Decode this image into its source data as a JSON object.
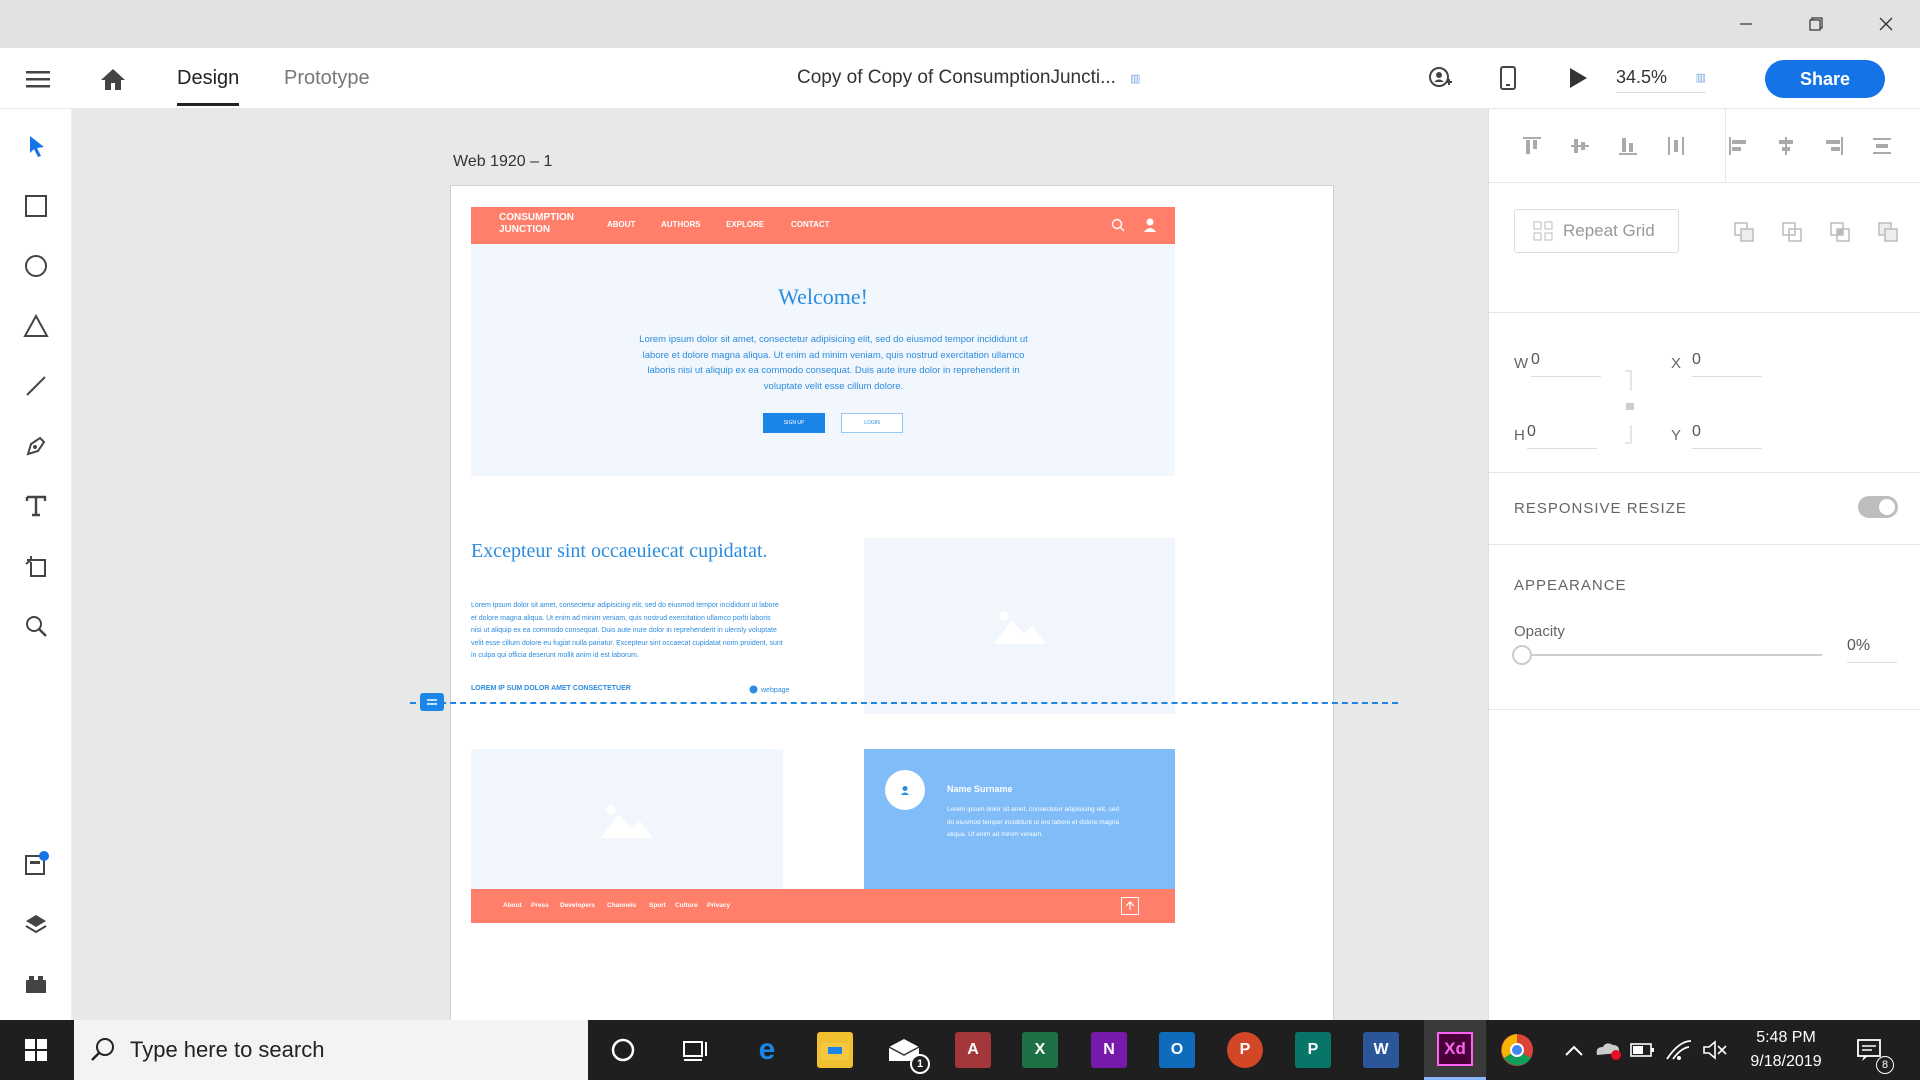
{
  "window": {
    "min_icon": "minimize-icon",
    "restore_icon": "restore-icon",
    "close_icon": "close-icon"
  },
  "toolbar": {
    "menu_icon": "hamburger-menu-icon",
    "home_icon": "home-icon",
    "tabs": [
      {
        "label": "Design",
        "active": true
      },
      {
        "label": "Prototype",
        "active": false
      }
    ],
    "doc_title": "Copy of Copy of ConsumptionJuncti...",
    "zoom": "34.5%",
    "share_label": "Share"
  },
  "tools": [
    "select-icon",
    "rectangle-icon",
    "ellipse-icon",
    "polygon-icon",
    "line-icon",
    "pen-icon",
    "text-icon",
    "artboard-icon",
    "zoom-icon",
    "assets-icon",
    "layers-icon",
    "plugins-icon"
  ],
  "canvas": {
    "artboard_label": "Web 1920 – 1",
    "site": {
      "logo": "CONSUMPTION JUNCTION",
      "nav": [
        "ABOUT",
        "AUTHORS",
        "EXPLORE",
        "CONTACT"
      ],
      "welcome": "Welcome!",
      "hero_text": "Lorem ipsum dolor sit amet, consectetur adipisicing elit, sed do eiusmod tempor incididunt ut labore et dolore magna aliqua. Ut enim ad minim veniam, quis nostrud exercitation ullamco laboris nisi ut aliquip ex ea commodo consequat. Duis aute irure dolor in reprehenderit in voluptate velit esse cillum dolore.",
      "signup": "SIGN UP",
      "login": "LOGIN",
      "section_title": "Excepteur sint occaeuiecat cupidatat.",
      "section_text": "Lorem ipsum dolor sit amet, consectetur adipisicing elit, sed do eiusmod tempor incididunt ut labore et dolore magna aliqua. Ut enim ad minim veniam, quis nostrud exercitation ullamco porlti laboris nisi ut aliquip ex ea commodo consequat. Duis aute irure dolor in reprehenderit in ulensly voluptate velit esse cillum dolore eu fugiat nulla pariatur. Excepteur sint occaecat cupidatat norin proident, sunt in culpa qui officia deserunt mollit anim id est laborum.",
      "section_link": "LOREM IP SUM DOLOR AMET CONSECTETUER",
      "section_web": "webpage",
      "card_name": "Name Surname",
      "card_text": "Lorem ipsum dolor sit amet, consectetur adipisicing elit, sed do eiusmod tempor incididunt ut ero labore et dolore magna aliqua. Ut enim ad minim veniam.",
      "footer_links": [
        "About",
        "Press",
        "Developers",
        "Channels",
        "Sport",
        "Culture",
        "Privacy"
      ]
    }
  },
  "panel": {
    "repeat_grid": "Repeat Grid",
    "w_label": "W",
    "w_value": "0",
    "h_label": "H",
    "h_value": "0",
    "x_label": "X",
    "x_value": "0",
    "y_label": "Y",
    "y_value": "0",
    "responsive_resize": "RESPONSIVE RESIZE",
    "appearance": "APPEARANCE",
    "opacity_label": "Opacity",
    "opacity_value": "0%"
  },
  "taskbar": {
    "search_placeholder": "Type here to search",
    "mail_badge": "1",
    "time": "5:48 PM",
    "date": "9/18/2019",
    "notif_count": "8"
  }
}
